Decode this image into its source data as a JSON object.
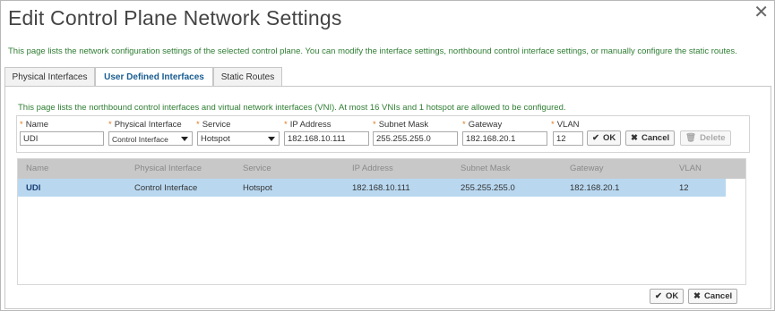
{
  "dialog": {
    "title": "Edit Control Plane Network Settings",
    "close": "✕",
    "description": "This page lists the network configuration settings of the selected control plane. You can modify the interface settings, northbound control interface settings, or manually configure the static routes."
  },
  "tabs": [
    {
      "label": "Physical Interfaces",
      "active": false
    },
    {
      "label": "User Defined Interfaces",
      "active": true
    },
    {
      "label": "Static Routes",
      "active": false
    }
  ],
  "panel": {
    "description": "This page lists the northbound control interfaces and virtual network interfaces (VNI). At most 16 VNIs and 1 hotspot are allowed to be configured."
  },
  "form": {
    "required_mark": "*",
    "name": {
      "label": "Name",
      "value": "UDI"
    },
    "physical_interface": {
      "label": "Physical Interface",
      "value": "Control Interface"
    },
    "service": {
      "label": "Service",
      "value": "Hotspot"
    },
    "ip_address": {
      "label": "IP Address",
      "value": "182.168.10.111"
    },
    "subnet_mask": {
      "label": "Subnet Mask",
      "value": "255.255.255.0"
    },
    "gateway": {
      "label": "Gateway",
      "value": "182.168.20.1"
    },
    "vlan": {
      "label": "VLAN",
      "value": "12"
    },
    "ok_label": "OK",
    "cancel_label": "Cancel",
    "delete_label": "Delete"
  },
  "grid": {
    "columns": [
      "Name",
      "Physical Interface",
      "Service",
      "IP Address",
      "Subnet Mask",
      "Gateway",
      "VLAN"
    ],
    "rows": [
      [
        "UDI",
        "Control Interface",
        "Hotspot",
        "182.168.10.111",
        "255.255.255.0",
        "182.168.20.1",
        "12"
      ]
    ]
  },
  "footer": {
    "ok_label": "OK",
    "cancel_label": "Cancel"
  },
  "colors": {
    "accent_text": "#2e7d32",
    "selected_row": "#b9d8f0",
    "header_bg": "#c8c8c8",
    "required": "#e07a1f"
  }
}
